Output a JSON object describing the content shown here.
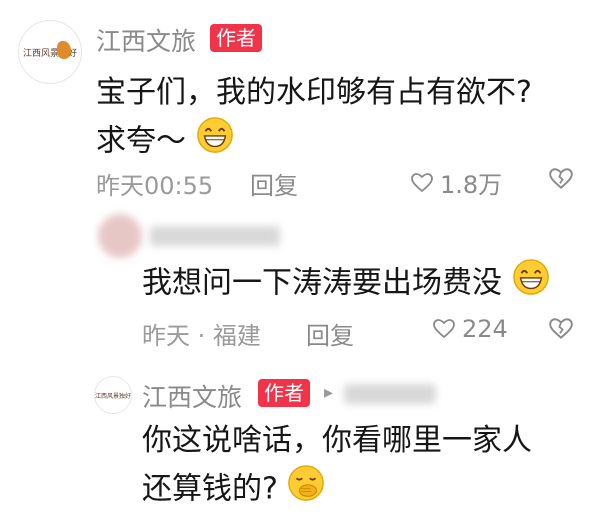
{
  "comment1": {
    "author": "江西文旅",
    "badge": "作者",
    "avatar_text": "江西风景独好",
    "text_line1": "宝子们，我的水印够有占有欲不?",
    "text_line2": "求夸～",
    "time": "昨天00:55",
    "reply_label": "回复",
    "likes": "1.8万"
  },
  "comment2": {
    "text": "我想问一下涛涛要出场费没",
    "time": "昨天",
    "dot": "·",
    "location": "福建",
    "reply_label": "回复",
    "likes": "224"
  },
  "comment3": {
    "author": "江西文旅",
    "badge": "作者",
    "reply_arrow": "▸",
    "text_line1": "你这说啥话，你看哪里一家人",
    "text_line2": "还算钱的?"
  },
  "icons": {
    "grin": "grinning-face-icon",
    "hand_over_mouth": "face-with-hand-over-mouth-icon",
    "heart": "heart-outline-icon",
    "broken_heart": "broken-heart-outline-icon"
  },
  "colors": {
    "badge": "#f2344b",
    "emoji": "#ffcc33"
  }
}
